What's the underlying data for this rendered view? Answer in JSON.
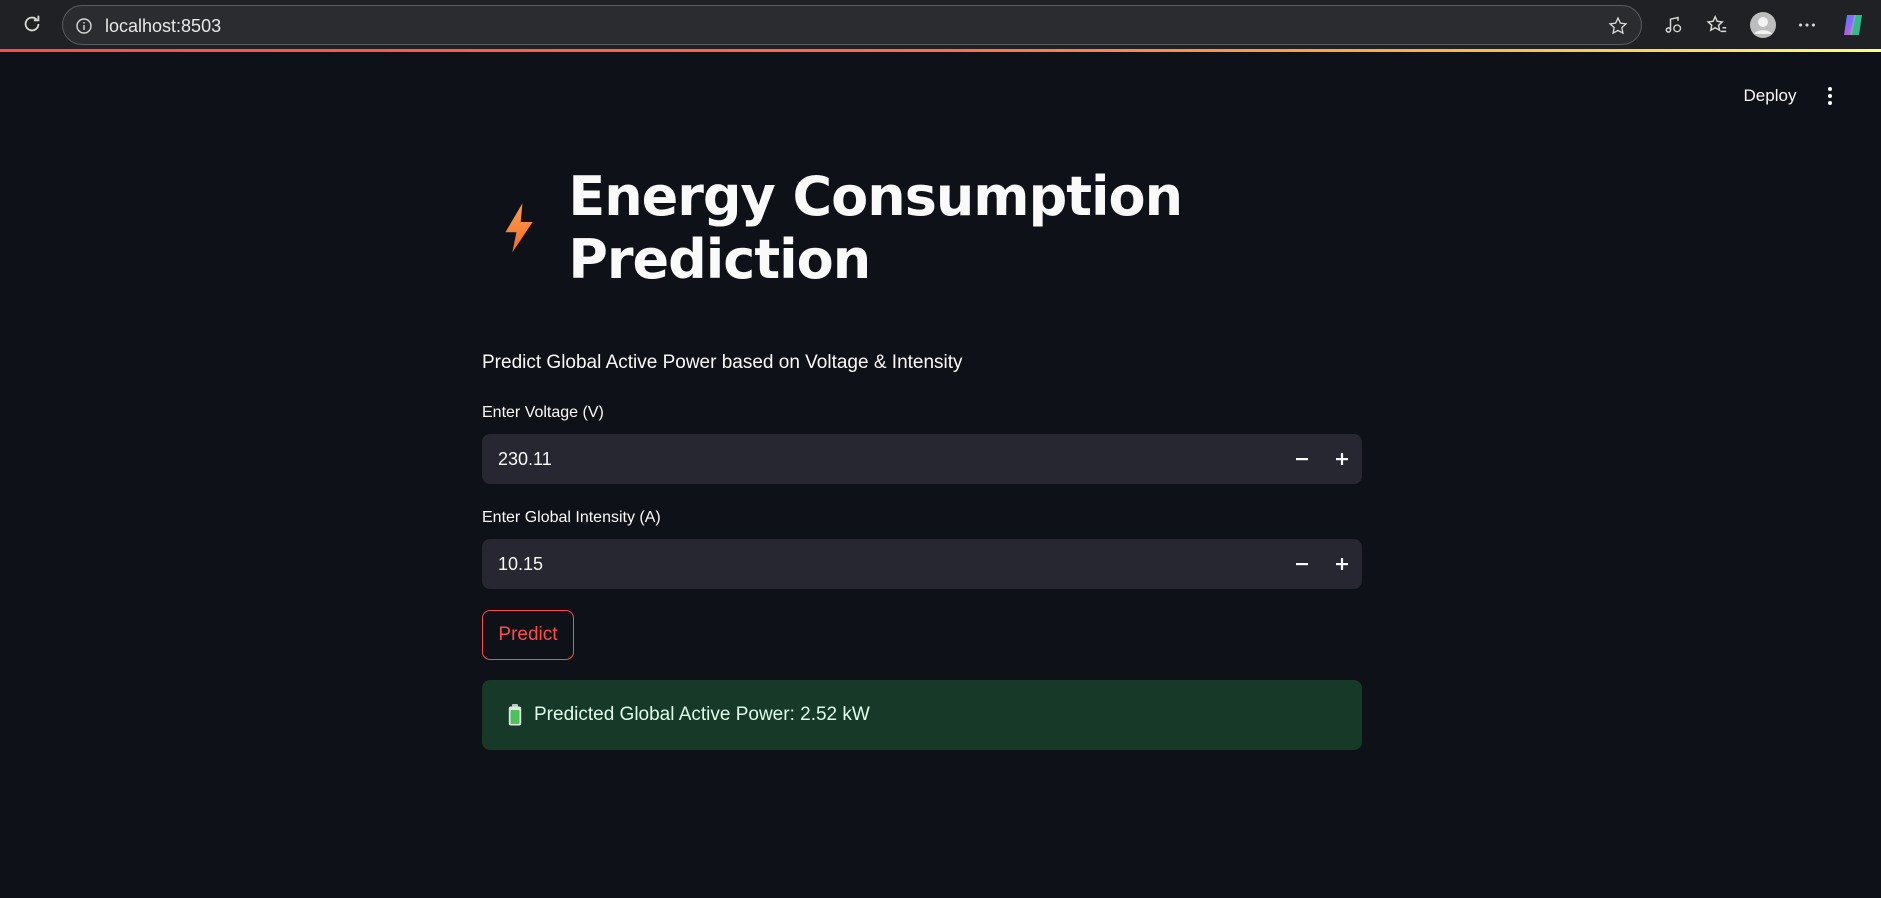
{
  "browser": {
    "url": "localhost:8503"
  },
  "header": {
    "deploy_label": "Deploy"
  },
  "app": {
    "title": "Energy Consumption Prediction",
    "subtitle": "Predict Global Active Power based on Voltage & Intensity",
    "voltage": {
      "label": "Enter Voltage (V)",
      "value": "230.11"
    },
    "intensity": {
      "label": "Enter Global Intensity (A)",
      "value": "10.15"
    },
    "predict_label": "Predict",
    "result_text": "Predicted Global Active Power: 2.52 kW"
  },
  "colors": {
    "background": "#0e1117",
    "accent": "#ff4b4b",
    "success_bg": "#173928",
    "input_bg": "#262730"
  },
  "icons": [
    "reload-icon",
    "info-icon",
    "star-icon",
    "music-icon",
    "favorites-icon",
    "profile-icon",
    "more-icon",
    "copilot-icon",
    "kebab-menu-icon",
    "lightning-icon",
    "minus-icon",
    "plus-icon",
    "battery-icon"
  ]
}
